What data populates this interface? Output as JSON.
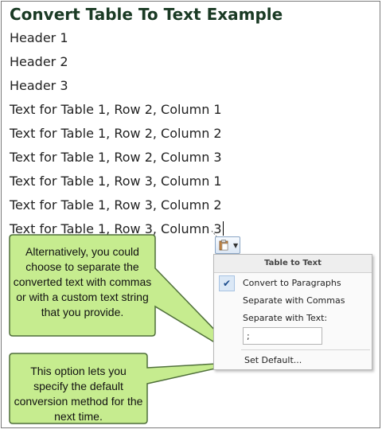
{
  "document": {
    "title": "Convert Table To Text Example",
    "lines": [
      "Header 1",
      "Header 2",
      "Header 3",
      "Text for Table 1, Row 2, Column 1",
      "Text for Table 1, Row 2, Column 2",
      "Text for Table 1, Row 2, Column 3",
      "Text for Table 1, Row 3, Column 1",
      "Text for Table 1, Row 3, Column 2",
      "Text for Table 1, Row 3, Column 3"
    ]
  },
  "paste_button": {
    "icon": "clipboard-icon",
    "arrow_icon": "dropdown-arrow-icon"
  },
  "menu": {
    "header": "Table to Text",
    "items": {
      "convert_paragraphs": "Convert to Paragraphs",
      "separate_commas": "Separate with Commas",
      "separate_text": "Separate with Text:",
      "separator_value": ";",
      "set_default": "Set Default..."
    },
    "checked_item": "convert_paragraphs"
  },
  "callouts": {
    "top": "Alternatively, you could choose to separate the converted text with commas or with a custom text string that you provide.",
    "bottom": "This option lets you specify the default conversion method for the next time."
  },
  "colors": {
    "callout_fill": "#c6ec8f",
    "callout_stroke": "#4f6f3a",
    "title_color": "#1a3a24"
  }
}
